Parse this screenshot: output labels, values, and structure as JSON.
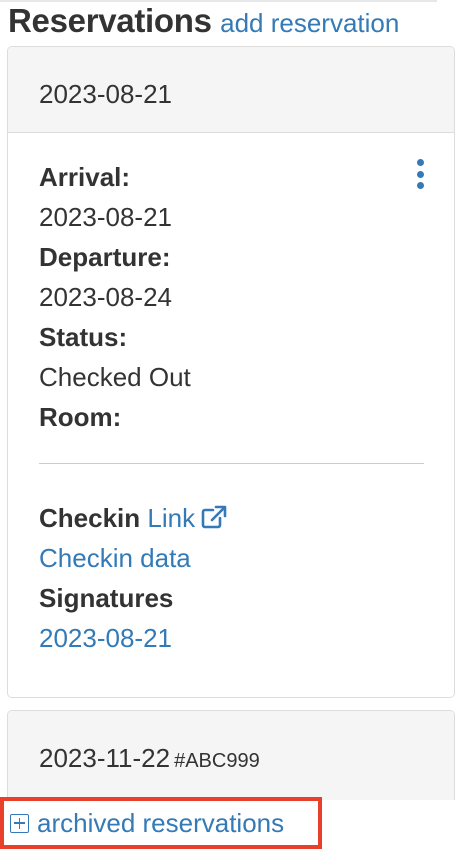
{
  "header": {
    "title": "Reservations",
    "add_link": "add reservation"
  },
  "reservations": [
    {
      "heading": "2023-08-21",
      "arrival_label": "Arrival:",
      "arrival": "2023-08-21",
      "departure_label": "Departure:",
      "departure": "2023-08-24",
      "status_label": "Status:",
      "status": "Checked Out",
      "room_label": "Room:",
      "room": "",
      "checkin_label": "Checkin",
      "checkin_link": "Link",
      "checkin_data_link": "Checkin data",
      "signatures_label": "Signatures",
      "signature_date": "2023-08-21",
      "menu_icon": "kebab-menu-icon",
      "link_icon": "external-link-icon"
    },
    {
      "heading": "2023-11-22",
      "reference": "#ABC999"
    }
  ],
  "archived": {
    "label": "archived reservations",
    "icon": "plus-square-icon"
  },
  "colors": {
    "link": "#337ab7",
    "highlight_border": "#e8402a",
    "panel_heading_bg": "#f5f5f5",
    "panel_border": "#dddddd"
  }
}
